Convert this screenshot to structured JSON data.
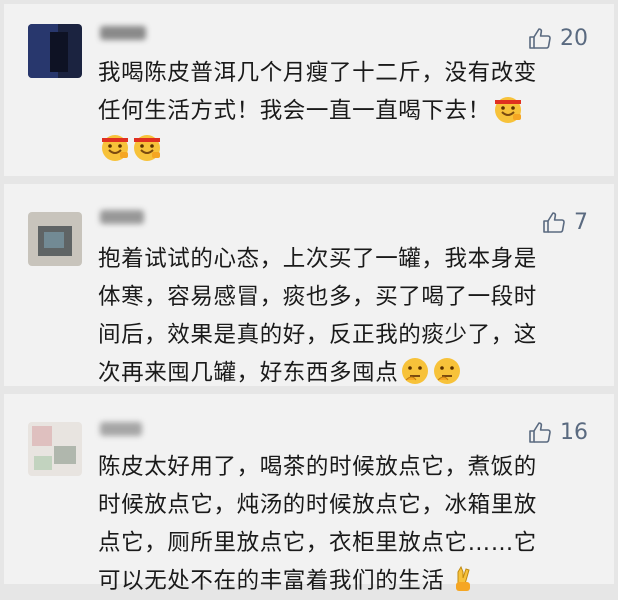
{
  "comments": [
    {
      "likes": "20",
      "text": "我喝陈皮普洱几个月瘦了十二斤，没有改变\n任何生活方式！我会一直一直喝下去！",
      "emoji_icons": [
        "headband-face-emoji",
        "headband-face-emoji",
        "headband-face-emoji"
      ]
    },
    {
      "likes": "7",
      "text": "抱着试试的心态，上次买了一罐，我本身是\n体寒，容易感冒，痰也多，买了喝了一段时\n间后，效果是真的好，反正我的痰少了，这\n次再来囤几罐，好东西多囤点",
      "emoji_icons": [
        "thinking-face-emoji",
        "thinking-face-emoji"
      ]
    },
    {
      "likes": "16",
      "text": "陈皮太好用了，喝茶的时候放点它，煮饭的\n时候放点它，炖汤的时候放点它，冰箱里放\n点它，厕所里放点它，衣柜里放点它……它\n可以无处不在的丰富着我们的生活",
      "emoji_icons": [
        "victory-hand-emoji"
      ]
    }
  ],
  "colors": {
    "like": "#5a6a80",
    "card": "#f2f2f2",
    "separator": "#e6e6e6"
  },
  "icons": {
    "like": "thumbs-up-icon"
  }
}
